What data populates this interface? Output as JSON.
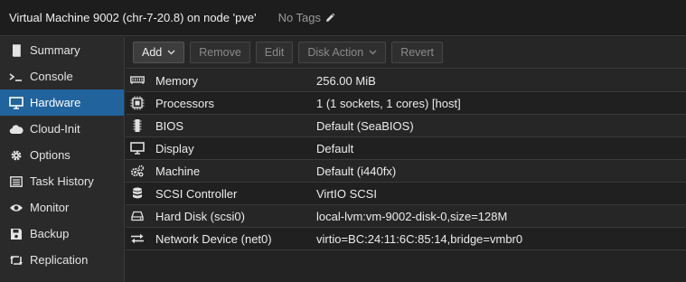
{
  "header": {
    "title": "Virtual Machine 9002 (chr-7-20.8) on node 'pve'",
    "tags": "No Tags"
  },
  "sidebar": {
    "items": [
      {
        "label": "Summary",
        "icon": "book-icon"
      },
      {
        "label": "Console",
        "icon": "terminal-icon"
      },
      {
        "label": "Hardware",
        "icon": "monitor-icon",
        "active": true
      },
      {
        "label": "Cloud-Init",
        "icon": "cloud-icon"
      },
      {
        "label": "Options",
        "icon": "gear-icon"
      },
      {
        "label": "Task History",
        "icon": "list-icon"
      },
      {
        "label": "Monitor",
        "icon": "eye-icon"
      },
      {
        "label": "Backup",
        "icon": "floppy-icon"
      },
      {
        "label": "Replication",
        "icon": "retweet-icon"
      }
    ]
  },
  "toolbar": {
    "add": "Add",
    "remove": "Remove",
    "edit": "Edit",
    "disk_action": "Disk Action",
    "revert": "Revert"
  },
  "hardware": [
    {
      "key": "Memory",
      "value": "256.00 MiB",
      "icon": "memory-icon"
    },
    {
      "key": "Processors",
      "value": "1 (1 sockets, 1 cores) [host]",
      "icon": "cpu-icon"
    },
    {
      "key": "BIOS",
      "value": "Default (SeaBIOS)",
      "icon": "chip-icon"
    },
    {
      "key": "Display",
      "value": "Default",
      "icon": "desktop-icon"
    },
    {
      "key": "Machine",
      "value": "Default (i440fx)",
      "icon": "cogs-icon"
    },
    {
      "key": "SCSI Controller",
      "value": "VirtIO SCSI",
      "icon": "database-icon"
    },
    {
      "key": "Hard Disk (scsi0)",
      "value": "local-lvm:vm-9002-disk-0,size=128M",
      "icon": "hdd-icon"
    },
    {
      "key": "Network Device (net0)",
      "value": "virtio=BC:24:11:6C:85:14,bridge=vmbr0",
      "icon": "exchange-icon"
    }
  ],
  "colors": {
    "accent": "#21639d",
    "background": "#242424"
  }
}
